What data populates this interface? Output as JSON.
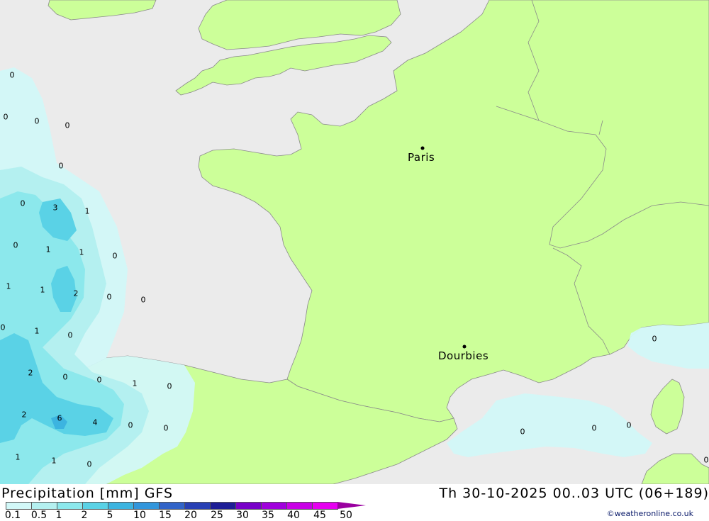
{
  "header": {
    "title": "Precipitation [mm]",
    "model": "GFS",
    "datetime": "Th 30-10-2025 00..03 UTC (06+189)",
    "credit": "©weatheronline.co.uk"
  },
  "legend": {
    "colors": [
      "#d2f8f8",
      "#b4f0f0",
      "#8ce8ec",
      "#5ad2e6",
      "#3cb4e0",
      "#3296dc",
      "#3264c8",
      "#2840b4",
      "#1e1e96",
      "#7800c8",
      "#a000dc",
      "#c800e6",
      "#e600f0",
      "#b400b4"
    ],
    "labels": [
      "0.1",
      "0.5",
      "1",
      "2",
      "5",
      "10",
      "15",
      "20",
      "25",
      "30",
      "35",
      "40",
      "45",
      "50"
    ]
  },
  "map": {
    "land_color": "#ccff99",
    "sea_color": "#ebebeb",
    "cities": [
      {
        "name": "Paris"
      },
      {
        "name": "Dourbies"
      }
    ],
    "precip_values": [
      "0",
      "0",
      "0",
      "0",
      "0",
      "0",
      "3",
      "1",
      "0",
      "1",
      "1",
      "0",
      "1",
      "1",
      "2",
      "0",
      "0",
      "0",
      "1",
      "0",
      "2",
      "0",
      "0",
      "1",
      "0",
      "2",
      "6",
      "4",
      "0",
      "0",
      "1",
      "1",
      "0",
      "0",
      "0",
      "0",
      "0",
      "0",
      "0"
    ]
  }
}
